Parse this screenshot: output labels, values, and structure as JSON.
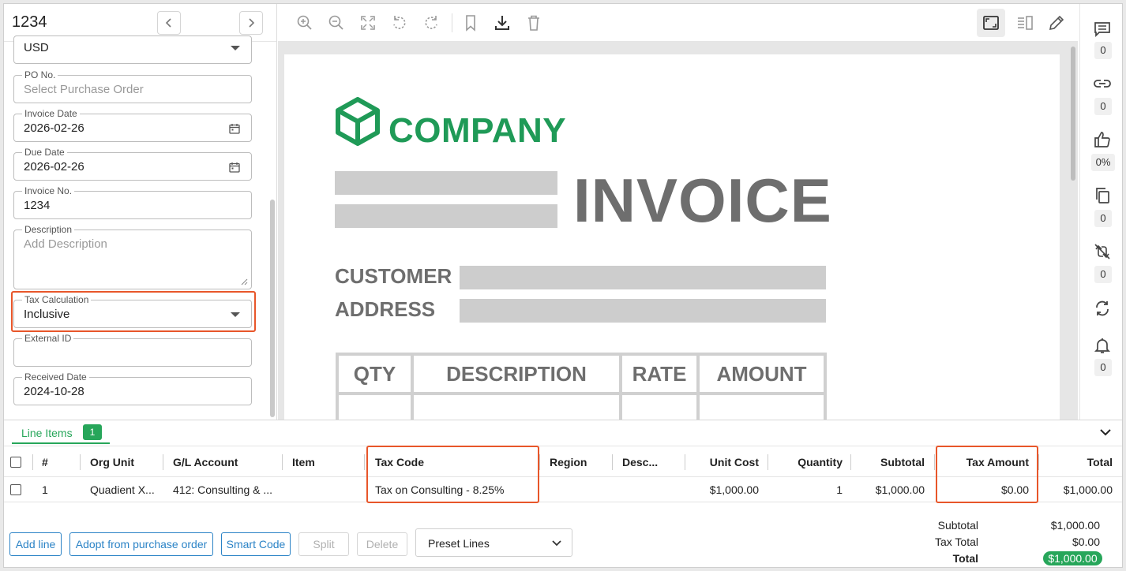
{
  "header": {
    "title": "1234"
  },
  "form": {
    "currency": {
      "value": "USD"
    },
    "po": {
      "label": "PO No.",
      "placeholder": "Select Purchase Order"
    },
    "invoice_date": {
      "label": "Invoice Date",
      "value": "2026-02-26"
    },
    "due_date": {
      "label": "Due Date",
      "value": "2026-02-26"
    },
    "invoice_no": {
      "label": "Invoice No.",
      "value": "1234"
    },
    "description": {
      "label": "Description",
      "placeholder": "Add Description"
    },
    "tax_calculation": {
      "label": "Tax Calculation",
      "value": "Inclusive"
    },
    "external_id": {
      "label": "External ID",
      "value": ""
    },
    "received_date": {
      "label": "Received Date",
      "value": "2024-10-28"
    }
  },
  "document": {
    "company": "COMPANY",
    "title": "INVOICE",
    "customer_label": "CUSTOMER",
    "address_label": "ADDRESS",
    "table_headers": [
      "QTY",
      "DESCRIPTION",
      "RATE",
      "AMOUNT"
    ],
    "brand_color": "#1f9a57"
  },
  "rail": {
    "comments_count": "0",
    "links_count": "0",
    "approval_pct": "0%",
    "duplicates_count": "0",
    "sync_count": "0",
    "alerts_count": "0"
  },
  "line_items": {
    "tab_label": "Line Items",
    "tab_count": "1",
    "columns": [
      "#",
      "Org Unit",
      "G/L Account",
      "Item",
      "Tax Code",
      "Region",
      "Desc...",
      "Unit Cost",
      "Quantity",
      "Subtotal",
      "Tax Amount",
      "Total"
    ],
    "rows": [
      {
        "num": "1",
        "org_unit": "Quadient X...",
        "gl_account": "412: Consulting & ...",
        "item": "",
        "tax_code": "Tax on Consulting - 8.25%",
        "region": "",
        "desc": "",
        "unit_cost": "$1,000.00",
        "quantity": "1",
        "subtotal": "$1,000.00",
        "tax_amount": "$0.00",
        "total": "$1,000.00"
      }
    ]
  },
  "actions": {
    "add_line": "Add line",
    "adopt_po": "Adopt from purchase order",
    "smart_code": "Smart Code",
    "split": "Split",
    "delete": "Delete",
    "preset_lines": "Preset Lines"
  },
  "totals": {
    "subtotal_label": "Subtotal",
    "subtotal_value": "$1,000.00",
    "tax_total_label": "Tax Total",
    "tax_total_value": "$0.00",
    "total_label": "Total",
    "total_value": "$1,000.00"
  },
  "colors": {
    "accent": "#27a65a",
    "link": "#2b83c6",
    "highlight": "#e8562a"
  }
}
